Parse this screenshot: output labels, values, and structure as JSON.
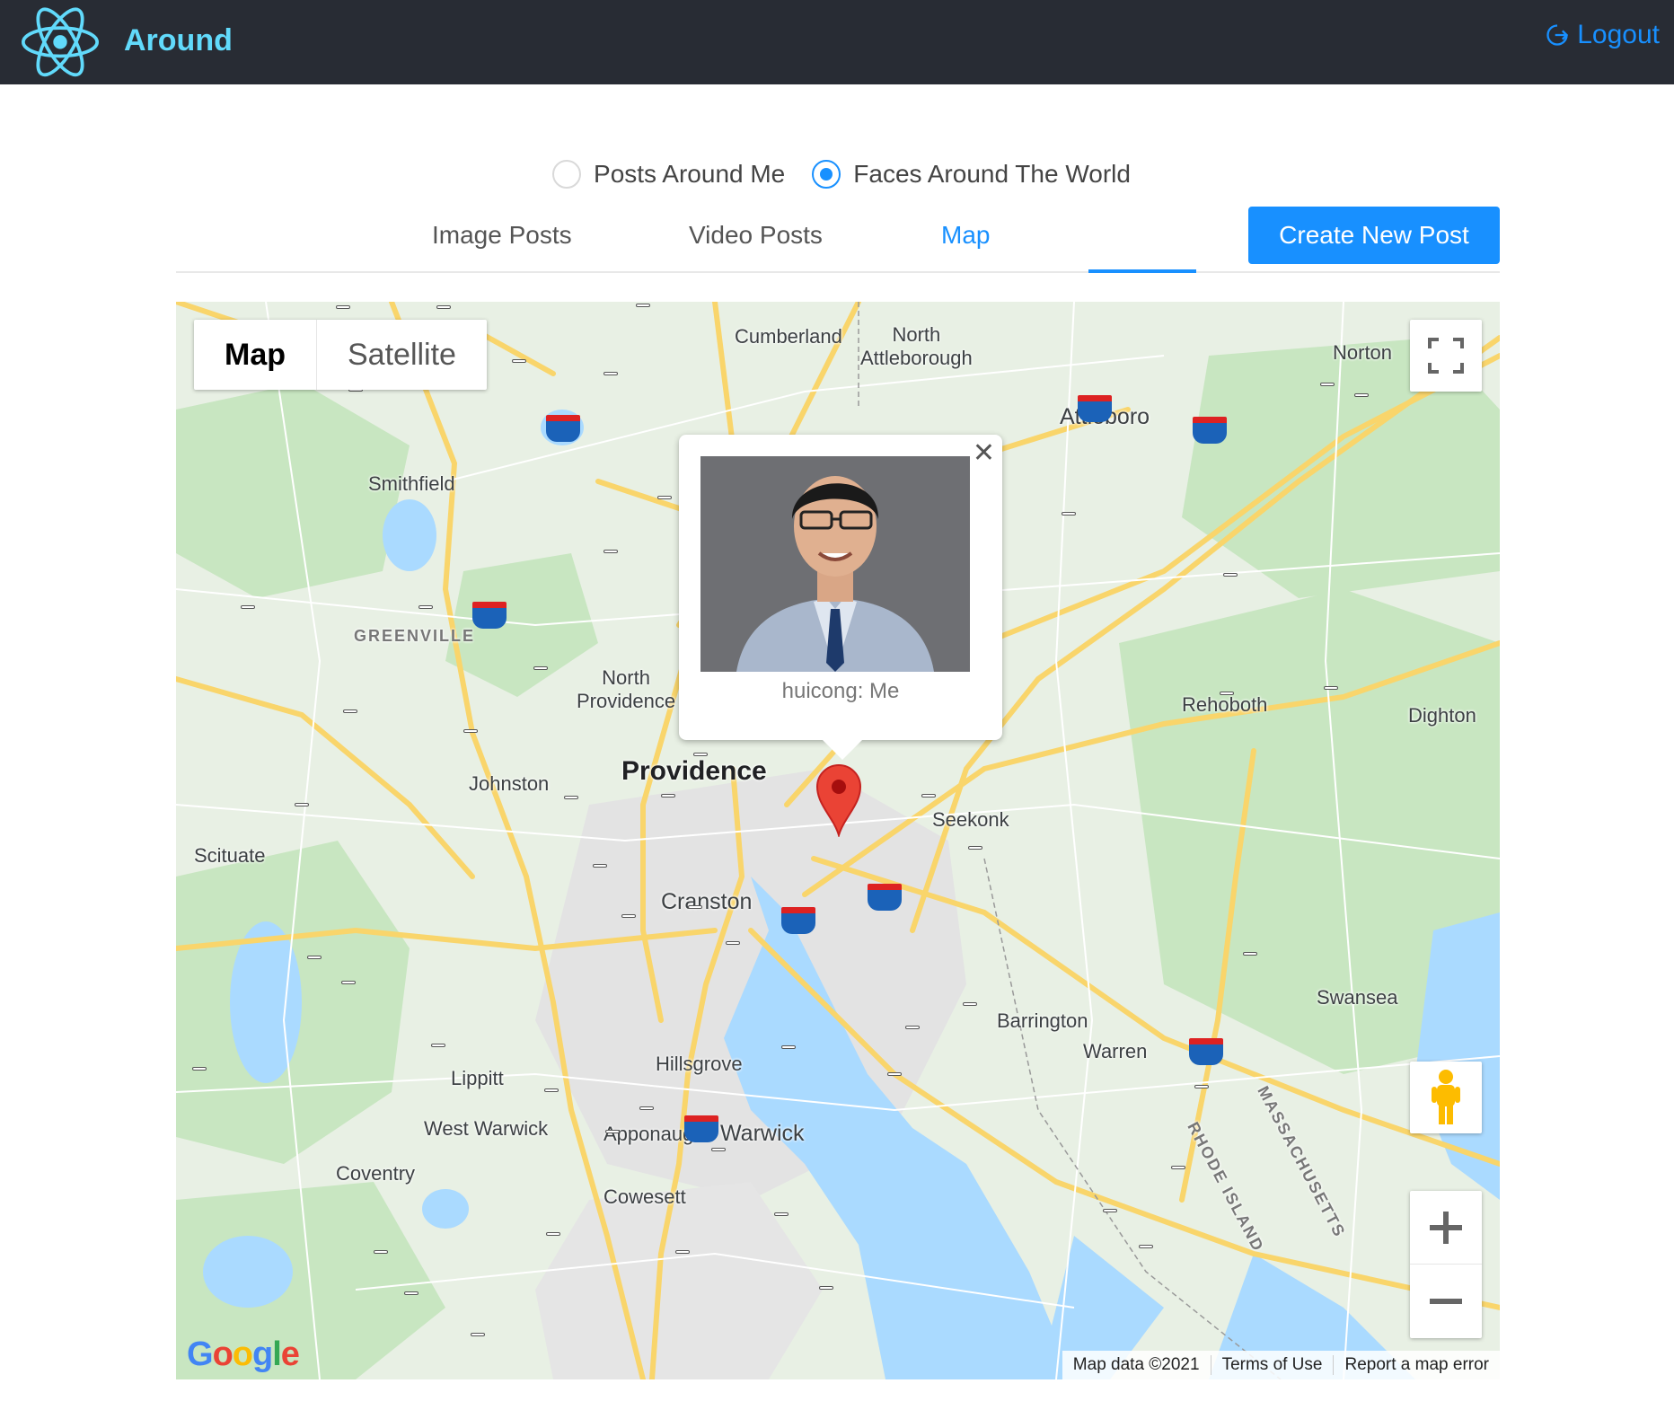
{
  "header": {
    "app_title": "Around",
    "logout_label": "Logout",
    "brand_color": "#61dafb",
    "bg_color": "#282c34"
  },
  "filter": {
    "options": [
      "Posts Around Me",
      "Faces Around The World"
    ],
    "selected": "Faces Around The World"
  },
  "tabs": {
    "items": [
      "Image Posts",
      "Video Posts",
      "Map"
    ],
    "active": "Map",
    "create_label": "Create New Post"
  },
  "map": {
    "type_options": [
      "Map",
      "Satellite"
    ],
    "type_selected": "Map",
    "places": {
      "providence": "Providence",
      "cranston": "Cranston",
      "warwick": "Warwick",
      "north_providence": "North\nProvidence",
      "johnston": "Johnston",
      "smithfield": "Smithfield",
      "greenville": "GREENVILLE",
      "scituate": "Scituate",
      "cumberland": "Cumberland",
      "north_attleborough": "North\nAttleborough",
      "attleboro": "Attleboro",
      "norton": "Norton",
      "rehoboth": "Rehoboth",
      "dighton": "Dighton",
      "seekonk": "Seekonk",
      "swansea": "Swansea",
      "barrington": "Barrington",
      "warren": "Warren",
      "hillsgrove": "Hillsgrove",
      "apponaug": "Apponaug",
      "lippitt": "Lippitt",
      "west_warwick": "West Warwick",
      "coventry": "Coventry",
      "cowesett": "Cowesett",
      "rhode_island": "RHODE ISLAND",
      "massachusetts": "MASSACHUSETTS"
    },
    "popup_caption": "huicong: Me",
    "attribution": [
      "Map data ©2021",
      "Terms of Use",
      "Report a map error"
    ],
    "google_logo": "Google"
  }
}
